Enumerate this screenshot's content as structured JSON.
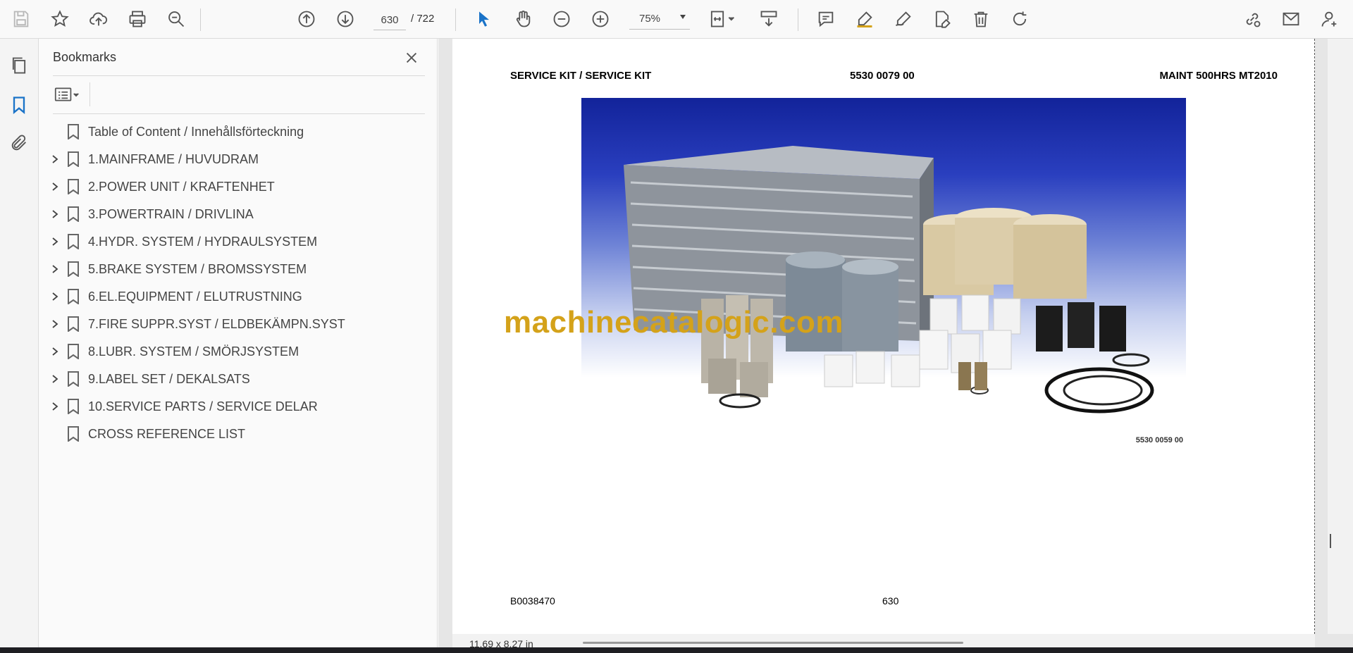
{
  "toolbar": {
    "page_current": "630",
    "page_total": "/  722",
    "zoom": "75%"
  },
  "sidebar": {
    "title": "Bookmarks",
    "items": [
      {
        "label": "Table of Content / Innehållsförteckning",
        "expandable": false
      },
      {
        "label": "1.MAINFRAME / HUVUDRAM",
        "expandable": true
      },
      {
        "label": "2.POWER UNIT / KRAFTENHET",
        "expandable": true
      },
      {
        "label": "3.POWERTRAIN / DRIVLINA",
        "expandable": true
      },
      {
        "label": "4.HYDR. SYSTEM / HYDRAULSYSTEM",
        "expandable": true
      },
      {
        "label": "5.BRAKE SYSTEM / BROMSSYSTEM",
        "expandable": true
      },
      {
        "label": "6.EL.EQUIPMENT / ELUTRUSTNING",
        "expandable": true
      },
      {
        "label": "7.FIRE SUPPR.SYST / ELDBEKÄMPN.SYST",
        "expandable": true
      },
      {
        "label": "8.LUBR. SYSTEM / SMÖRJSYSTEM",
        "expandable": true
      },
      {
        "label": "9.LABEL SET / DEKALSATS",
        "expandable": true
      },
      {
        "label": "10.SERVICE PARTS / SERVICE DELAR",
        "expandable": true
      },
      {
        "label": "CROSS REFERENCE LIST",
        "expandable": false
      }
    ]
  },
  "page": {
    "header_left": "SERVICE KIT / SERVICE KIT",
    "header_center": "5530 0079 00",
    "header_right": "MAINT 500HRS MT2010",
    "image_code": "5530 0059 00",
    "watermark": "machinecatalogic.com",
    "footer_left": "B0038470",
    "footer_center": "630"
  },
  "status": {
    "dimensions": "11,69 x 8,27 in"
  },
  "colors": {
    "accent_blue": "#1a73c8",
    "watermark": "#d4a21a"
  }
}
